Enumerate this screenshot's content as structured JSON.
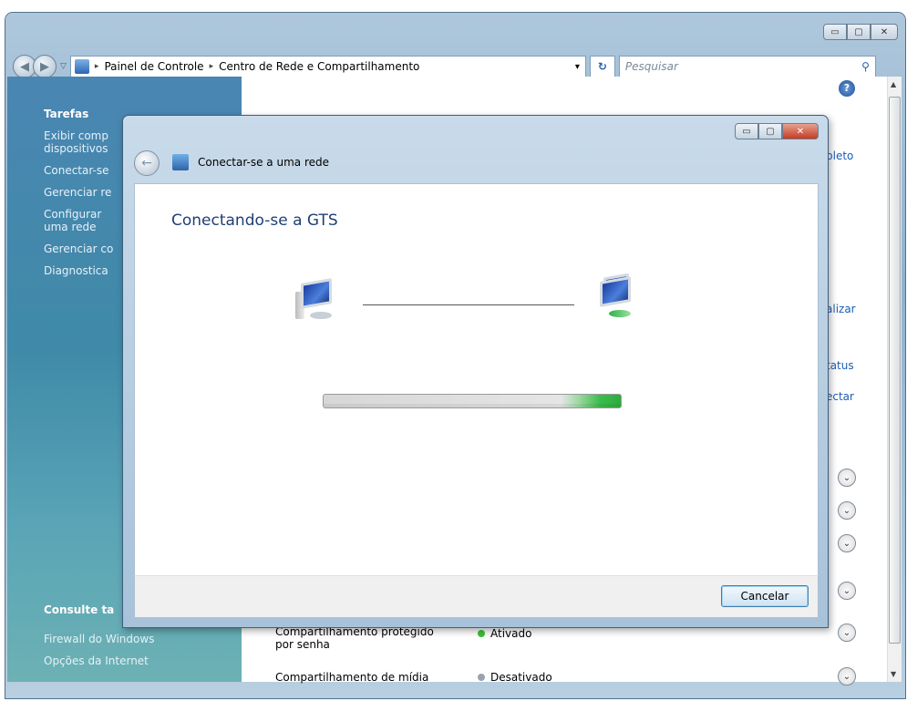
{
  "window": {
    "min": "▭",
    "max": "▢",
    "close": "✕"
  },
  "address": {
    "sep": "▸",
    "crumbs": [
      "Painel de Controle",
      "Centro de Rede e Compartilhamento"
    ],
    "dropdown": "▾",
    "refresh": "↻",
    "search_placeholder": "Pesquisar",
    "search_icon": "⚲"
  },
  "sidebar": {
    "tasks_heading": "Tarefas",
    "links": [
      "Exibir comp",
      "dispositivos",
      "Conectar-se",
      "Gerenciar re",
      "Configurar",
      "uma rede",
      "Gerenciar co",
      "Diagnostica"
    ],
    "see_also_heading": "Consulte ta",
    "bottom_links": [
      "Firewall do Windows",
      "Opções da Internet"
    ]
  },
  "main": {
    "help": "?",
    "peeks": [
      "pleto",
      "alizar",
      "tatus",
      "ectar"
    ],
    "rows": [
      {
        "label_line1": "Compartilhamento protegido",
        "label_line2": "por senha",
        "status": "Ativado",
        "status_color": "#3bbf3b"
      },
      {
        "label_line1": "Compartilhamento de mídia",
        "label_line2": "",
        "status": "Desativado",
        "status_color": "#9aa3ad"
      }
    ],
    "chevron": "⌄"
  },
  "dialog": {
    "title": "Conectar-se a uma rede",
    "back": "←",
    "heading": "Conectando-se a GTS",
    "progress_percent": 100,
    "cancel": "Cancelar"
  }
}
